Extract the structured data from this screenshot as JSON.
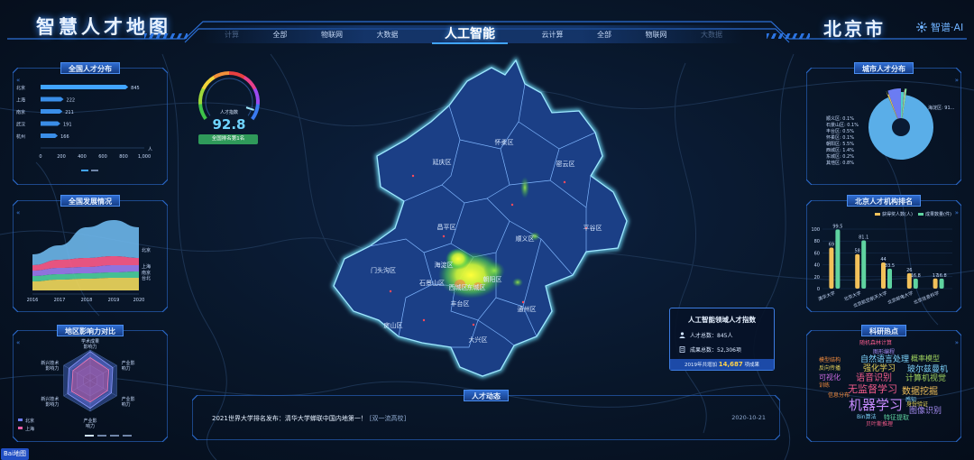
{
  "header": {
    "app_title": "智慧人才地图",
    "city": "北京市",
    "brand": "智谱·AI",
    "tabs": [
      {
        "label": "计算",
        "state": "faded"
      },
      {
        "label": "全部",
        "state": "normal"
      },
      {
        "label": "物联网",
        "state": "normal"
      },
      {
        "label": "大数据",
        "state": "normal"
      },
      {
        "label": "人工智能",
        "state": "active"
      },
      {
        "label": "云计算",
        "state": "normal"
      },
      {
        "label": "全部",
        "state": "normal"
      },
      {
        "label": "物联网",
        "state": "normal"
      },
      {
        "label": "大数据",
        "state": "faded"
      }
    ]
  },
  "left": {
    "national": {
      "title": "全国人才分布",
      "unit": "人",
      "chart_data": {
        "type": "bar",
        "orientation": "horizontal",
        "categories": [
          "北京",
          "上海",
          "南京",
          "武汉",
          "杭州"
        ],
        "values": [
          845,
          222,
          211,
          191,
          166
        ],
        "ticks": [
          "0",
          "200",
          "400",
          "600",
          "800",
          "1,000"
        ],
        "xlim": [
          0,
          1000
        ]
      }
    },
    "development": {
      "title": "全国发展情况",
      "chart_data": {
        "type": "area",
        "x": [
          "2016",
          "2017",
          "2018",
          "2019",
          "2020"
        ],
        "series": [
          {
            "name": "北京",
            "color": "#6db6ea"
          },
          {
            "name": "上海",
            "color": "#ff5b8b"
          },
          {
            "name": "南京",
            "color": "#9f7cf2"
          },
          {
            "name": "台北",
            "color": "#4ed0a0"
          },
          {
            "name": "",
            "color": "#f2d95c"
          }
        ]
      }
    },
    "influence": {
      "title": "地区影响力对比",
      "axes": [
        "学术成果影响力",
        "产业影响力",
        "产业影响力",
        "产业影响力",
        "新兴技术影响力",
        "新兴技术影响力"
      ],
      "legend": [
        {
          "name": "北京",
          "color": "#6d7bf0"
        },
        {
          "name": "上海",
          "color": "#e85fa6"
        }
      ]
    }
  },
  "gauge": {
    "label": "人才指数",
    "value": "92.8",
    "level": 0.928,
    "rank": "全国排名第1名"
  },
  "map": {
    "districts": [
      "延庆区",
      "怀柔区",
      "密云区",
      "昌平区",
      "顺义区",
      "平谷区",
      "门头沟区",
      "海淀区",
      "朝阳区",
      "东城区",
      "西城区",
      "石景山区",
      "丰台区",
      "房山区",
      "通州区",
      "大兴区"
    ]
  },
  "index_box": {
    "title": "人工智能领域人才指数",
    "talents": "人才总数：845人",
    "outputs": "成果总数：52,306项",
    "footer_prefix": "2019年共增加",
    "footer_value": "14,687",
    "footer_suffix": "项成果"
  },
  "news": {
    "title": "人才动态",
    "headline": "2021世界大学排名发布：清华大学蝉联中国内地第一！",
    "tag": "[双一流高校]",
    "date": "2020-10-21"
  },
  "right": {
    "city": {
      "title": "城市人才分布",
      "chart_data": {
        "type": "pie",
        "slices": [
          {
            "name": "海淀区",
            "label": "海淀区: 91...",
            "value": 91.0,
            "color": "#5aaee8"
          },
          {
            "name": "顺义区",
            "label": "顺义区: 0.1%",
            "value": 0.1,
            "color": "#f28a3c"
          },
          {
            "name": "石景山区",
            "label": "石景山区: 0.1%",
            "value": 0.1,
            "color": "#9fd35e"
          },
          {
            "name": "丰台区",
            "label": "丰台区: 0.5%",
            "value": 0.5,
            "color": "#e8d45a"
          },
          {
            "name": "怀柔区",
            "label": "怀柔区: 0.1%",
            "value": 0.1,
            "color": "#c86be0"
          },
          {
            "name": "朝阳区",
            "label": "朝阳区: 5.5%",
            "value": 5.5,
            "color": "#6b7cf2"
          },
          {
            "name": "西城区",
            "label": "西城区: 1.4%",
            "value": 1.4,
            "color": "#4fd0c8"
          },
          {
            "name": "东城区",
            "label": "东城区: 0.2%",
            "value": 0.2,
            "color": "#f25b8b"
          },
          {
            "name": "其他",
            "label": "其他区: 0.8%",
            "value": 0.8,
            "color": "#8ee0a0"
          }
        ]
      }
    },
    "institutions": {
      "title": "北京人才机构排名",
      "chart_data": {
        "type": "bar",
        "legend": [
          "获得奖人数(人)",
          "成果数量(件)"
        ],
        "colors": [
          "#f2c15a",
          "#5fd3a0"
        ],
        "categories": [
          "清华大学",
          "北京大学",
          "北京航空航天大学",
          "北京邮电大学",
          "北京信息科学"
        ],
        "series": [
          {
            "name": "获得奖人数(人)",
            "values": [
              69,
              58,
              44,
              26,
              17
            ]
          },
          {
            "name": "成果数量(件)",
            "values": [
              99.5,
              81.1,
              33.5,
              16.8,
              16.8
            ]
          }
        ],
        "ticks": [
          "0",
          "20",
          "40",
          "60",
          "80",
          "100"
        ],
        "ylim": [
          0,
          100
        ]
      }
    },
    "hot": {
      "title": "科研热点",
      "words": [
        {
          "text": "随机森林计算",
          "color": "#f25b8b"
        },
        {
          "text": "图形编程",
          "color": "#a58cf2"
        },
        {
          "text": "模型结构",
          "color": "#f28a3c"
        },
        {
          "text": "自然语言处理",
          "color": "#7fd6ff"
        },
        {
          "text": "概率模型",
          "color": "#9fd35e"
        },
        {
          "text": "反向传播",
          "color": "#e8d45a"
        },
        {
          "text": "强化学习",
          "color": "#e8d45a"
        },
        {
          "text": "玻尔兹曼机",
          "color": "#7fd6ff"
        },
        {
          "text": "可视化",
          "color": "#c86be0"
        },
        {
          "text": "语音识别",
          "color": "#f25b8b"
        },
        {
          "text": "计算机视觉",
          "color": "#9fd35e"
        },
        {
          "text": "训练",
          "color": "#f28a3c"
        },
        {
          "text": "无监督学习",
          "color": "#f25b8b"
        },
        {
          "text": "数据挖掘",
          "color": "#f2c15a"
        },
        {
          "text": "信息分布",
          "color": "#f28a3c"
        },
        {
          "text": "感知",
          "color": "#7fd6ff"
        },
        {
          "text": "身份验证",
          "color": "#e8d45a"
        },
        {
          "text": "机器学习",
          "color": "#c88cff"
        },
        {
          "text": "图像识别",
          "color": "#a58cf2"
        },
        {
          "text": "Bin算法",
          "color": "#7fd6ff"
        },
        {
          "text": "特征提取",
          "color": "#5fd3a0"
        },
        {
          "text": "贝叶斯推理",
          "color": "#f25b8b"
        }
      ]
    }
  },
  "corner_logo": "Bai地图"
}
